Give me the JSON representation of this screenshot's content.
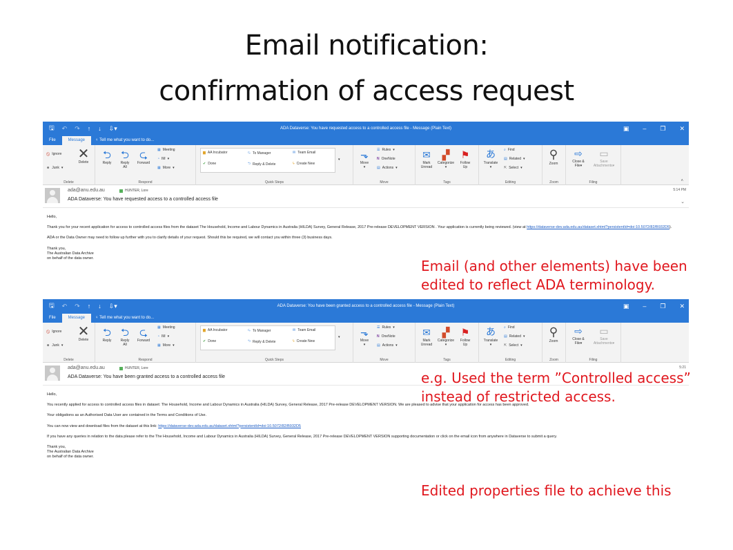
{
  "slide": {
    "title_line1": "Email notification:",
    "title_line2": "confirmation of access request"
  },
  "ribbon": {
    "tabs": [
      "File",
      "Message"
    ],
    "tell_me": "Tell me what you want to do...",
    "delete_group": {
      "label": "Delete",
      "ignore": "Ignore",
      "junk": "Junk",
      "delete": "Delete"
    },
    "respond_group": {
      "label": "Respond",
      "reply": "Reply",
      "reply_all_1": "Reply",
      "reply_all_2": "All",
      "forward": "Forward",
      "meeting": "Meeting",
      "im": "IM",
      "more": "More"
    },
    "quicksteps_group": {
      "label": "Quick Steps",
      "items": [
        "AA Incubator",
        "To Manager",
        "Team Email",
        "Done",
        "Reply & Delete",
        "Create New"
      ]
    },
    "move_group": {
      "label": "Move",
      "move": "Move",
      "rules": "Rules",
      "onenote": "OneNote",
      "actions": "Actions"
    },
    "tags_group": {
      "label": "Tags",
      "mark_unread_1": "Mark",
      "mark_unread_2": "Unread",
      "categorize": "Categorize",
      "follow_up_1": "Follow",
      "follow_up_2": "Up"
    },
    "editing_group": {
      "label": "Editing",
      "translate": "Translate",
      "find": "Find",
      "related": "Related",
      "select": "Select"
    },
    "zoom_group": {
      "label": "Zoom",
      "zoom": "Zoom"
    },
    "filing_group": {
      "label": "Filing",
      "close_file_1": "Close &",
      "close_file_2": "File",
      "save_att_1": "Save",
      "save_att_2": "Attachments"
    }
  },
  "email1": {
    "window_title": "ADA Dataverse: You have requested access to a controlled access file - Message (Plain Text)",
    "from": "ada@anu.edu.au",
    "to": "HUNTER, Lore",
    "subject": "ADA Dataverse: You have requested access to a controlled access file",
    "time": "5:14 PM",
    "greeting": "Hello,",
    "para1": "Thank you for your recent application for access to controlled access files from the dataset The Household, Income and Labour Dynamics in Australia (HILDA) Survey, General Release, 2017 Pre-release DEVELOPMENT VERSION . Your application is currently being reviewed. (view at ",
    "para1_link": "https://dataverse-dev.ada.edu.au/dataset.xhtml?persistentId=doi:10.5072/82/B932D5",
    "para1_end": ").",
    "para2": "ADA or the Data Owner may need to follow up further with you to clarify details of your request. Should this be required, we will contact you within three (3) business days.",
    "sign1": "Thank you,",
    "sign2": "The Australian Data Archive",
    "sign3": "on behalf of the data owner."
  },
  "email2": {
    "window_title": "ADA Dataverse: You have been granted access to a controlled access file - Message (Plain Text)",
    "from": "ada@anu.edu.au",
    "to": "HUNTER, Lore",
    "subject": "ADA Dataverse: You have been granted access to a controlled access file",
    "time": "5:21",
    "greeting": "Hello,",
    "para1": "You recently applied for access to controlled access files in dataset: The Household, Income and Labour Dynamics in Australia (HILDA) Survey, General Release, 2017 Pre-release DEVELOPMENT VERSION. We are pleased to advise that your application for access has been approved.",
    "para2": "Your obligations as an Authorised Data User are contained in the Terms and Conditions of Use.",
    "para3": "You can now view and download files from the dataset at this link: ",
    "para3_link": "https://dataverse-dev.ada.edu.au/dataset.xhtml?persistentId=doi:10.5072/82/B932D5",
    "para4": "If you have any queries in relation to the data please refer to the The Household, Income and Labour Dynamics in Australia (HILDA) Survey, General Release, 2017 Pre-release DEVELOPMENT VERSION supporting documentation or click on the email icon from anywhere in Dataverse to submit a query.",
    "sign1": "Thank you,",
    "sign2": "The Australian Data Archive",
    "sign3": "on behalf of the data owner."
  },
  "notes": {
    "note1_line1": "Email (and other elements) have been",
    "note1_line2": "edited to reflect ADA terminology.",
    "note2_line1": "e.g. Used the term ”Controlled access”",
    "note2_line2": "instead of restricted access.",
    "note3": "Edited properties file to achieve this"
  },
  "colors": {
    "outlook_blue": "#2b79d7",
    "note_red": "#e0171e",
    "link_blue": "#1a5bc4"
  }
}
